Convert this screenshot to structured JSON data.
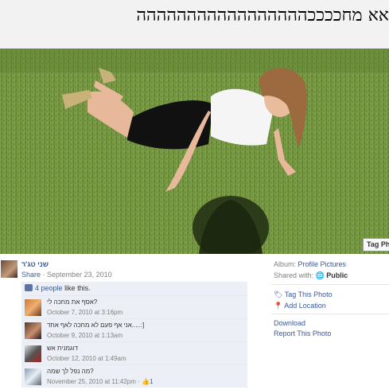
{
  "banner": {
    "caption": "אא מחככככההההההההההההההההה"
  },
  "photo": {
    "tag_button": "Tag Ph"
  },
  "owner": {
    "name": "שני טג'ר",
    "share_label": "Share",
    "date": "September 23, 2010"
  },
  "likes": {
    "count": "4 people",
    "suffix": "like this."
  },
  "comments": [
    {
      "name": "אסף",
      "text": "אסף את מחכה לי?",
      "meta": "October 7, 2010 at 3:16pm",
      "likes": ""
    },
    {
      "name": "שני טג'ר",
      "text": "אני אף פעם לא מחכה לאף אחד.....:]",
      "meta": "October 9, 2010 at 1:13am",
      "likes": ""
    },
    {
      "name": "רפי פורטל",
      "text": "דוגמנית אש",
      "meta": "October 12, 2010 at 1:49am",
      "likes": ""
    },
    {
      "name": "קובי כהן",
      "text": "מה נפל לך שמה?",
      "meta": "November 25, 2010 at 11:42pm",
      "likes": "1"
    }
  ],
  "sidebar": {
    "album_label": "Album:",
    "album_value": "Profile Pictures",
    "shared_label": "Shared with:",
    "shared_value": "Public",
    "tag_photo": "Tag This Photo",
    "add_location": "Add Location",
    "download": "Download",
    "report": "Report This Photo"
  },
  "colors": {
    "link": "#3b5998",
    "meta": "#808080",
    "comment_bg": "#eceff5",
    "grass": "#6a8c3a"
  }
}
